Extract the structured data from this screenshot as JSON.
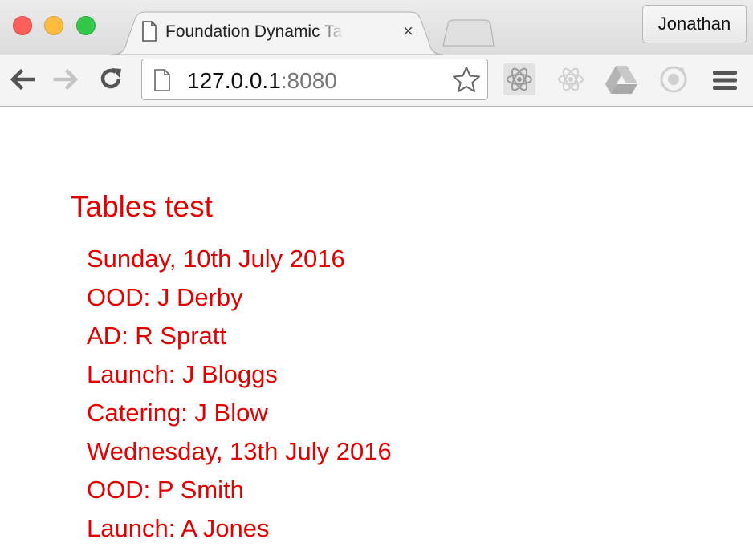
{
  "browser": {
    "tab": {
      "title": "Foundation Dynamic Tables",
      "close_glyph": "×"
    },
    "profile_name": "Jonathan",
    "address": {
      "host": "127.0.0.1",
      "port": ":8080"
    },
    "icons": {
      "back": "back-arrow-icon",
      "forward": "forward-arrow-icon",
      "reload": "reload-icon",
      "page": "page-icon",
      "bookmark": "star-icon",
      "extensions": [
        "react-icon",
        "react-icon-disabled",
        "google-drive-icon",
        "ionic-icon"
      ],
      "menu": "hamburger-menu-icon"
    }
  },
  "page": {
    "title": "Tables test",
    "entries": [
      "Sunday, 10th July 2016",
      "OOD: J Derby",
      "AD: R Spratt",
      "Launch: J Bloggs",
      "Catering: J Blow",
      "Wednesday, 13th July 2016",
      "OOD: P Smith",
      "Launch: A Jones"
    ],
    "text_color": "#e30000"
  }
}
